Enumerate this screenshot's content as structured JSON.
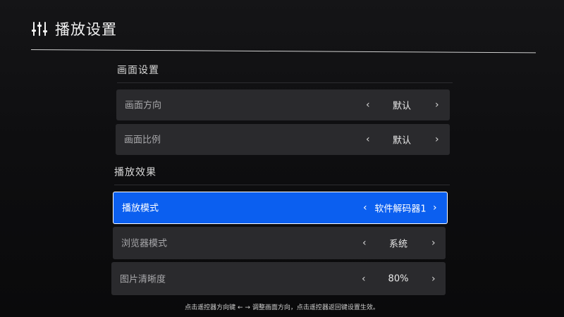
{
  "header": {
    "title": "播放设置",
    "icon": "sliders-icon"
  },
  "sections": [
    {
      "title": "画面设置",
      "rows": [
        {
          "label": "画面方向",
          "value": "默认"
        },
        {
          "label": "画面比例",
          "value": "默认"
        }
      ]
    },
    {
      "title": "播放效果",
      "rows": [
        {
          "label": "播放模式",
          "value": "软件解码器1",
          "selected": true
        },
        {
          "label": "浏览器模式",
          "value": "系统"
        },
        {
          "label": "图片清晰度",
          "value": "80%"
        }
      ]
    }
  ],
  "controls": {
    "prev_glyph": "‹",
    "next_glyph": "›"
  },
  "hint": "点击遥控器方向键 ← → 调整画面方向，点击遥控器返回键设置生效。",
  "colors": {
    "background": "#0e0e10",
    "row_background": "#2a2a2d",
    "selected_background": "#0b5ff0"
  }
}
